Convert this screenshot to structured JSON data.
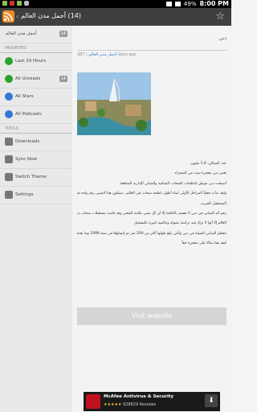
{
  "status_bar": {
    "battery": "49%",
    "time": "8:00 PM"
  },
  "app_bar": {
    "title": "(14) أجمل مدن العالم",
    "chevron": "‹"
  },
  "sidebar": {
    "top": {
      "label": "أجمل مدن العالم",
      "count": "14"
    },
    "favorites_header": "FAVORITES",
    "favorites": [
      {
        "label": "Last 24 Hours",
        "icon": "clock-icon"
      },
      {
        "label": "All Unreads",
        "count": "14",
        "icon": "unread-icon"
      },
      {
        "label": "All Stars",
        "icon": "star-icon"
      },
      {
        "label": "All Podcasts",
        "icon": "podcast-icon"
      }
    ],
    "tools_header": "TOOLS",
    "tools": [
      {
        "label": "Downloads",
        "icon": "download-icon"
      },
      {
        "label": "Sync Now",
        "icon": "sync-icon"
      },
      {
        "label": "Switch Theme",
        "icon": "theme-icon"
      },
      {
        "label": "Settings",
        "icon": "settings-icon"
      }
    ]
  },
  "article": {
    "title": "دبي",
    "count": "387",
    "source": "أجمل مدن العالم",
    "time": "days ago",
    "lines": [
      "عدد السكان: 1.6 مليون",
      "تعتبر دبي معجزة نبتت من الصحراء",
      "أصبحت دبي موطن لناطحات السحاب السكنية والمباني الإدارية الشاهقة",
      "ولقد بدأت فعلياً المراحل الأولى لبناء أطول ناطحة سحاب في العالم ، سيكون هذا المبنى رقم واحد في القائمة في",
      "المستقبل القريب.",
      "رقم أنه المباني في دبي لا تقسم بالكثافة إلا أن كل مبنى علامة المعنى وقد قامت بتشغيلات سحاب دبي بأكبر المباني في",
      "العالم إلا أنها لا تزال قيد دراسة عمولة وعالمية كبيرة بالتسجيل",
      "معظم المباني السيئة في دبي والتي يبلغ طولها أكثر من 200 متر تم إنشاؤها في سنة 1999 وما بعدها",
      "كيف هذا مثالا على معجزة حقاً"
    ],
    "visit_label": "Visit website"
  },
  "ad": {
    "title": "McAfee Antivirus & Security",
    "stars": "★★★★★",
    "reviews": "928829 Reviews"
  },
  "colors": {
    "accent": "#f08a24",
    "appbar": "#3f3f3f",
    "sidebar": "#e9e9e9"
  }
}
